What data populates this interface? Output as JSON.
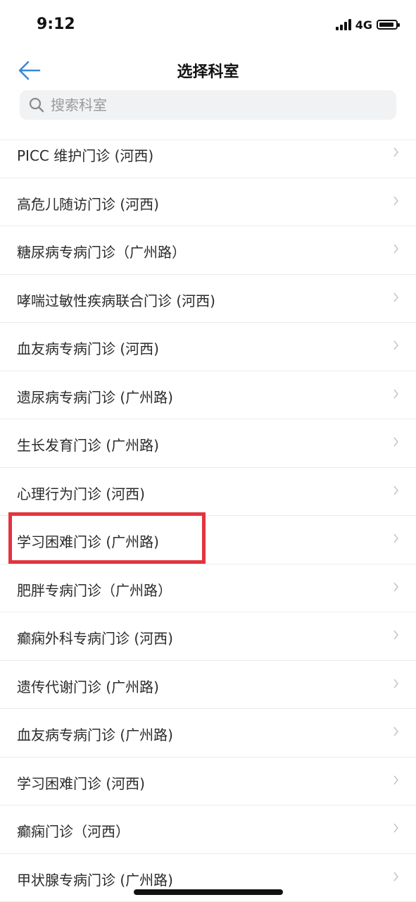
{
  "status_bar": {
    "time": "9:12",
    "network": "4G"
  },
  "header": {
    "title": "选择科室",
    "back_icon": "back-arrow-icon"
  },
  "search": {
    "placeholder": "搜索科室",
    "value": "",
    "icon": "search-icon"
  },
  "colors": {
    "accent": "#3b87d8",
    "highlight_border": "#e3343f"
  },
  "departments": [
    {
      "label": "PICC 维护门诊 (河西)"
    },
    {
      "label": "高危儿随访门诊 (河西)"
    },
    {
      "label": "糖尿病专病门诊（广州路）"
    },
    {
      "label": "哮喘过敏性疾病联合门诊 (河西)"
    },
    {
      "label": "血友病专病门诊 (河西)"
    },
    {
      "label": "遗尿病专病门诊 (广州路)"
    },
    {
      "label": "生长发育门诊 (广州路)"
    },
    {
      "label": "心理行为门诊 (河西)"
    },
    {
      "label": "学习困难门诊 (广州路)",
      "highlighted": true
    },
    {
      "label": "肥胖专病门诊（广州路）"
    },
    {
      "label": "癫痫外科专病门诊 (河西)"
    },
    {
      "label": "遗传代谢门诊 (广州路)"
    },
    {
      "label": "血友病专病门诊 (广州路)"
    },
    {
      "label": "学习困难门诊 (河西)"
    },
    {
      "label": "癫痫门诊（河西）"
    },
    {
      "label": "甲状腺专病门诊 (广州路)"
    }
  ]
}
